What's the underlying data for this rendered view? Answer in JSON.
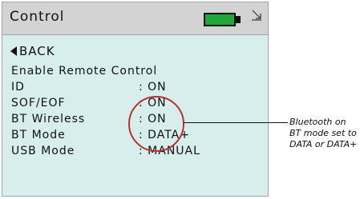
{
  "header": {
    "title": "Control",
    "battery_icon": "battery-full-icon",
    "download_icon": "download-icon"
  },
  "nav": {
    "back_icon": "triangle-left-icon",
    "back_label": "BACK"
  },
  "menu": {
    "heading": "Enable Remote Control",
    "rows": [
      {
        "label": "ID",
        "value": ": ON"
      },
      {
        "label": "SOF/EOF",
        "value": ": ON"
      },
      {
        "label": "BT Wireless",
        "value": ": ON"
      },
      {
        "label": "BT Mode",
        "value": ": DATA+"
      },
      {
        "label": "USB Mode",
        "value": ": MANUAL"
      }
    ]
  },
  "annotation": {
    "text": "Bluetooth on BT mode set to DATA or DATA+"
  },
  "colors": {
    "screen_bg": "#d7eeec",
    "titlebar_bg": "#d3d3d3",
    "battery_green": "#22a83a",
    "highlight_circle": "#b8322e"
  }
}
